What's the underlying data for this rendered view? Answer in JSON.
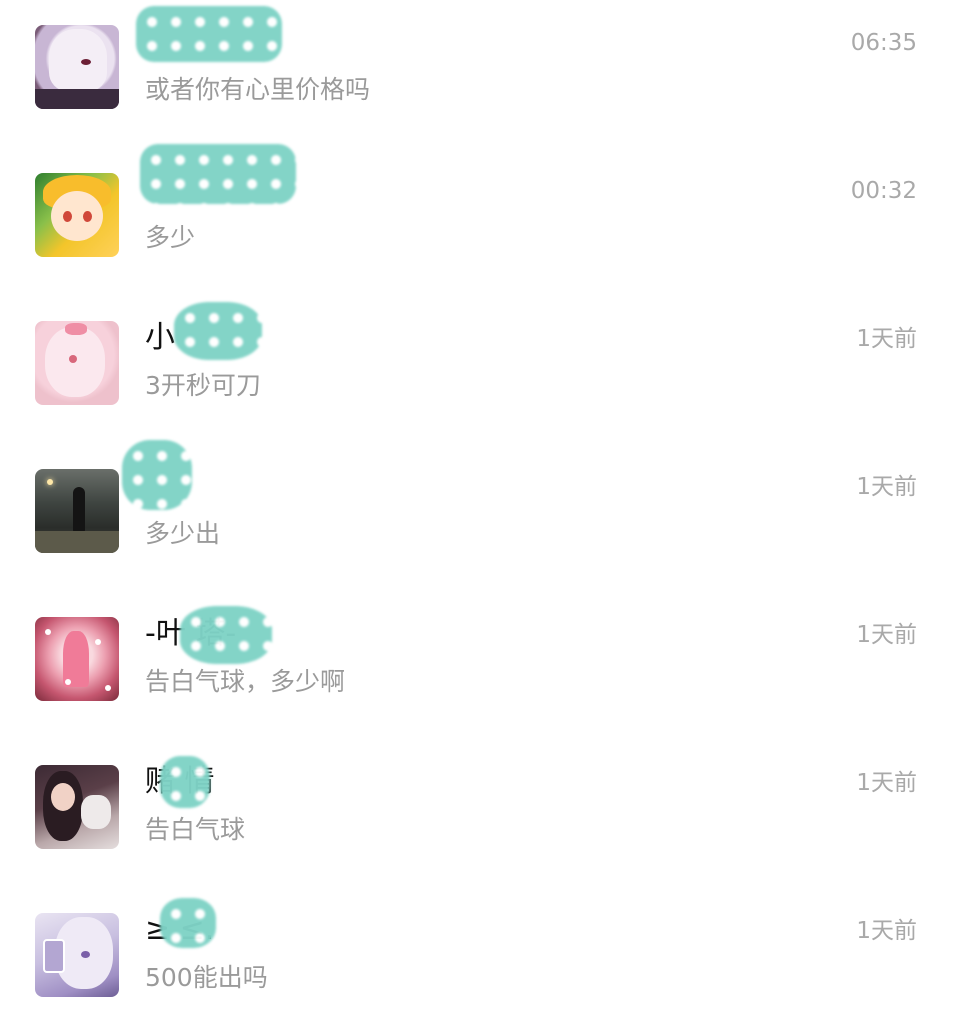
{
  "conversations": [
    {
      "name": "",
      "preview": "或者你有心里价格吗",
      "time": "06:35"
    },
    {
      "name": "",
      "preview": "多少",
      "time": "00:32"
    },
    {
      "name": "小",
      "preview": "3开秒可刀",
      "time": "1天前"
    },
    {
      "name": "",
      "preview": "多少出",
      "time": "1天前"
    },
    {
      "name": "-叶      塔-",
      "preview": "告白气球，多少啊",
      "time": "1天前"
    },
    {
      "name": "赌  情",
      "preview": "告白气球",
      "time": "1天前"
    },
    {
      "name": "≥  ≤.",
      "preview": "500能出吗",
      "time": "1天前"
    }
  ],
  "colors": {
    "name_text": "#111111",
    "preview_text": "#9a9a9a",
    "time_text": "#a9a9a9",
    "redaction": "#7fd3c6"
  },
  "icons": {
    "avatars": [
      "avatar-anime-white-hair",
      "avatar-anime-blonde",
      "avatar-anime-pink",
      "avatar-night-photo",
      "avatar-pink-dress",
      "avatar-girl-with-toy",
      "avatar-anime-purple"
    ]
  }
}
